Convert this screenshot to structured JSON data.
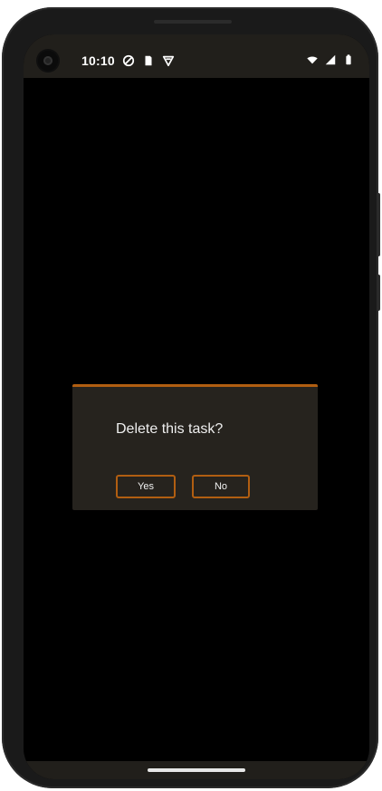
{
  "status_bar": {
    "time": "10:10",
    "left_icons": [
      "privacy-icon",
      "sd-card-icon",
      "vpn-icon"
    ],
    "right_icons": [
      "wifi-icon",
      "signal-icon",
      "battery-icon"
    ]
  },
  "dialog": {
    "title": "Delete this task?",
    "yes_label": "Yes",
    "no_label": "No"
  },
  "colors": {
    "accent": "#b15e11",
    "dialog_bg": "#26231e",
    "status_bg": "#211f1b"
  }
}
